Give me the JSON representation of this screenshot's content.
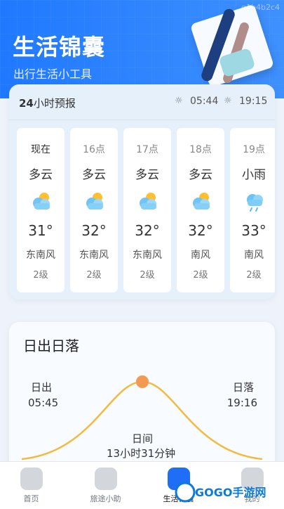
{
  "header": {
    "title": "生活锦囊",
    "subtitle": "出行生活小工具",
    "watermark": "q1b4b2c4"
  },
  "forecast": {
    "title_num": "24",
    "title_text": "小时预报",
    "sunrise": "05:44",
    "sunset": "19:15",
    "hours": [
      {
        "time": "现在",
        "cond": "多云",
        "temp": "31°",
        "wind": "东南风",
        "level": "2级",
        "icon": "cloudy-icon"
      },
      {
        "time": "16点",
        "cond": "多云",
        "temp": "32°",
        "wind": "东南风",
        "level": "2级",
        "icon": "cloudy-icon"
      },
      {
        "time": "17点",
        "cond": "多云",
        "temp": "32°",
        "wind": "东南风",
        "level": "2级",
        "icon": "cloudy-icon"
      },
      {
        "time": "18点",
        "cond": "多云",
        "temp": "32°",
        "wind": "南风",
        "level": "2级",
        "icon": "cloudy-icon"
      },
      {
        "time": "19点",
        "cond": "小雨",
        "temp": "33°",
        "wind": "南风",
        "level": "2级",
        "icon": "light-rain-icon"
      }
    ]
  },
  "sun_card": {
    "title": "日出日落",
    "sunrise_label": "日出",
    "sunrise_time": "05:45",
    "sunset_label": "日落",
    "sunset_time": "19:16",
    "day_label": "日间",
    "day_length": "13小时31分钟"
  },
  "tabs": [
    {
      "label": "首页",
      "active": false
    },
    {
      "label": "旅途小助",
      "active": false
    },
    {
      "label": "生活锦囊",
      "active": true
    },
    {
      "label": "我的",
      "active": false
    }
  ],
  "logo_text": "GOGO手游网"
}
